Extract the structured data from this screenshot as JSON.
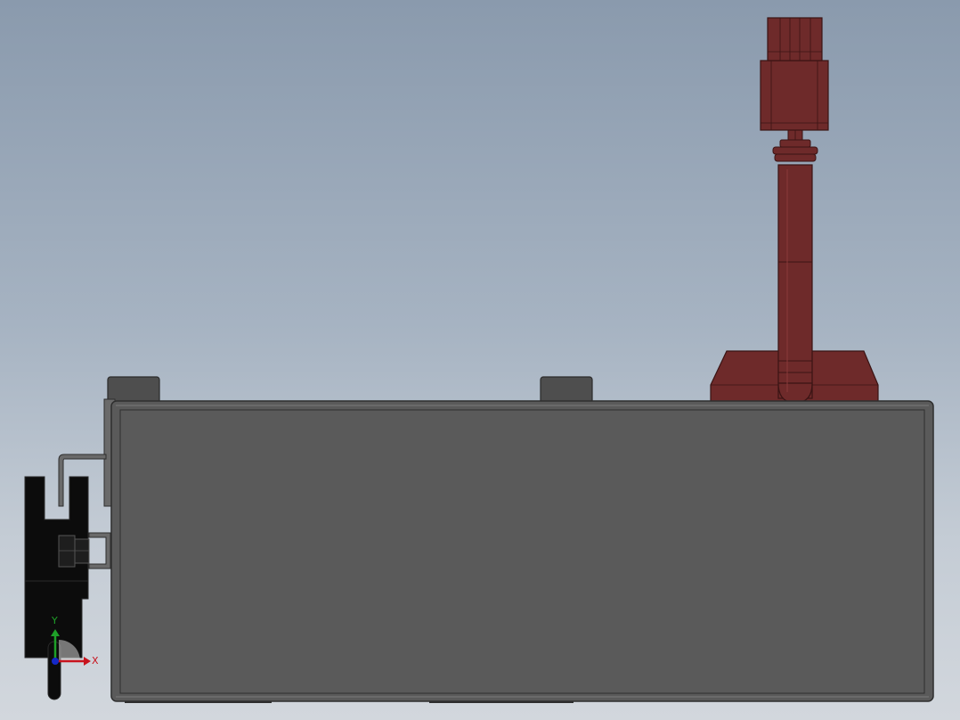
{
  "view": {
    "background_top": "#8a9aad",
    "background_bottom": "#d2d7dd"
  },
  "triad": {
    "x_label": "X",
    "y_label": "Y",
    "x_color": "#c8141e",
    "y_color": "#1ea028",
    "z_color": "#1428c8"
  },
  "colors": {
    "housing_fill": "#5a5a5a",
    "housing_edge": "#2e2e2e",
    "housing_rim": "#7a7a7a",
    "handle_fill": "#4e4e4e",
    "bracket_fill": "#6a6a6a",
    "clamp_fill": "#0c0c0c",
    "dispenser_fill": "#6e2a2a",
    "dispenser_edge": "#3a1414",
    "dispenser_light": "#8a3a3a"
  }
}
